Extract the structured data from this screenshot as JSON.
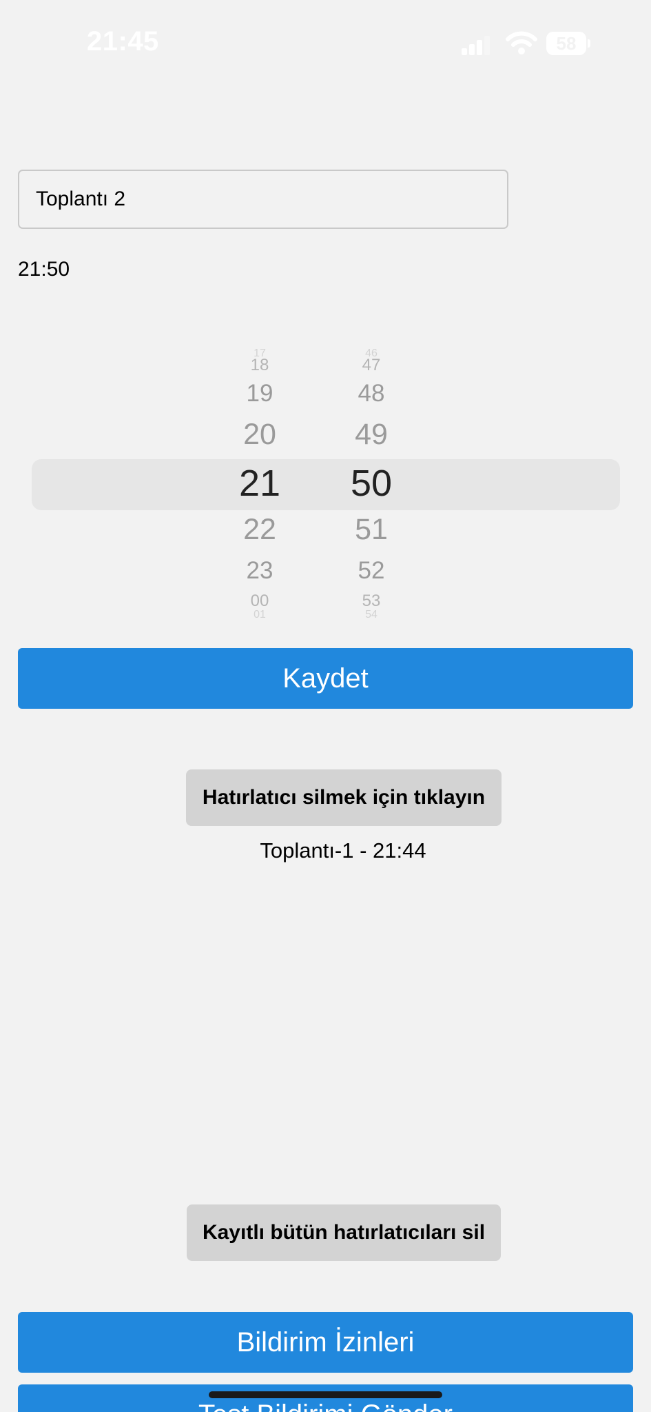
{
  "status_bar": {
    "time": "21:45",
    "battery_level": "58",
    "icons": [
      "signal-icon",
      "wifi-icon",
      "battery-icon"
    ],
    "signal_bars_active": 3,
    "signal_bars_total": 4
  },
  "form": {
    "name_value": "Toplantı 2",
    "selected_time": "21:50"
  },
  "time_picker": {
    "hours": [
      "17",
      "18",
      "19",
      "20",
      "21",
      "22",
      "23",
      "00",
      "01"
    ],
    "minutes": [
      "46",
      "47",
      "48",
      "49",
      "50",
      "51",
      "52",
      "53",
      "54"
    ],
    "selected_hour": "21",
    "selected_minute": "50"
  },
  "buttons": {
    "save": "Kaydet",
    "delete_reminder": "Hatırlatıcı silmek için tıklayın",
    "delete_all": "Kayıtlı bütün hatırlatıcıları sil",
    "notification_permissions": "Bildirim İzinleri",
    "send_test_notification": "Test Bildirimi Gönder"
  },
  "reminders": [
    {
      "label": "Toplantı-1 - 21:44"
    }
  ],
  "colors": {
    "background": "#f2f2f2",
    "primary": "#2188dd",
    "secondary": "#d3d3d3",
    "picker_highlight": "#e6e6e6"
  }
}
